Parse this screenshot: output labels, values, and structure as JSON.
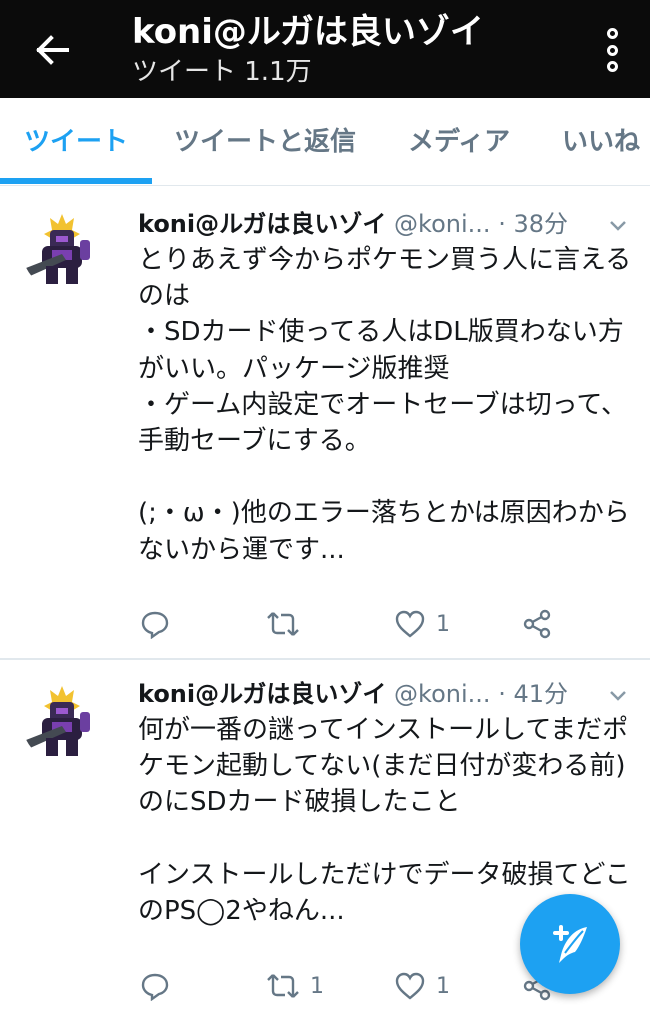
{
  "header": {
    "title": "koni@ルガは良いゾイ",
    "subtitle": "ツイート 1.1万",
    "back_icon": "arrow-left-icon",
    "more_icon": "more-vertical-icon"
  },
  "tabs": [
    {
      "label": "ツイート",
      "active": true
    },
    {
      "label": "ツイートと返信",
      "active": false
    },
    {
      "label": "メディア",
      "active": false
    },
    {
      "label": "いいね",
      "active": false
    }
  ],
  "tweets": [
    {
      "name": "koni@ルガは良いゾイ",
      "handle": "@koni...",
      "time": "· 38分",
      "text": "とりあえず今からポケモン買う人に言えるのは\n・SDカード使ってる人はDL版買わない方がいい。パッケージ版推奨\n・ゲーム内設定でオートセーブは切って、手動セーブにする。\n\n(;・ω・)他のエラー落ちとかは原因わからないから運です...",
      "reply_count": "",
      "retweet_count": "",
      "like_count": "1"
    },
    {
      "name": "koni@ルガは良いゾイ",
      "handle": "@koni...",
      "time": "· 41分",
      "text": "何が一番の謎ってインストールしてまだポケモン起動してない(まだ日付が変わる前)のにSDカード破損したこと\n\nインストールしただけでデータ破損てどこのPS◯2やねん...",
      "reply_count": "",
      "retweet_count": "1",
      "like_count": "1"
    }
  ],
  "fab": {
    "icon": "compose-tweet-icon"
  },
  "colors": {
    "accent": "#1da1f2",
    "header_bg": "#0b0b0b",
    "muted": "#657786"
  }
}
